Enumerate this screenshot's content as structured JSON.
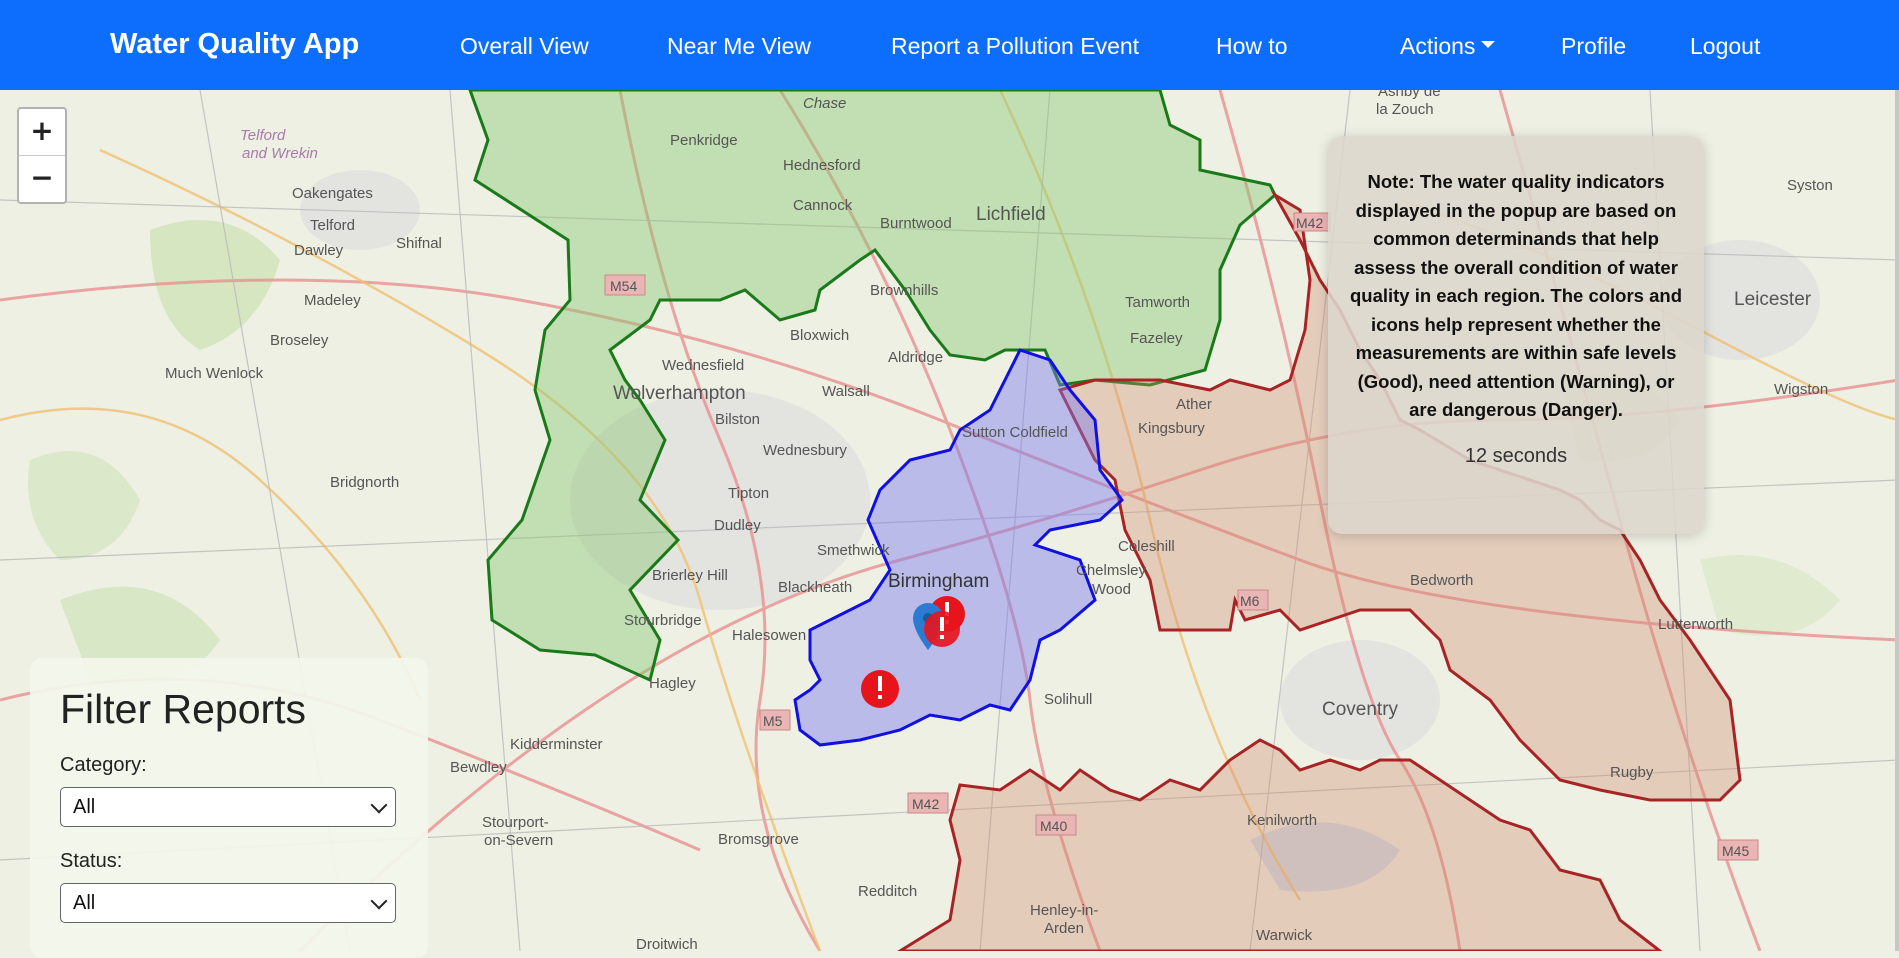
{
  "navbar": {
    "brand": "Water Quality App",
    "items": [
      {
        "label": "Overall View"
      },
      {
        "label": "Near Me View"
      },
      {
        "label": "Report a Pollution Event"
      },
      {
        "label": "How to"
      },
      {
        "label": "Actions"
      },
      {
        "label": "Profile"
      },
      {
        "label": "Logout"
      }
    ],
    "color": "#0d6efd"
  },
  "map": {
    "zoom_in": "+",
    "zoom_out": "−",
    "places": [
      "Telford and Wrekin",
      "Penkridge",
      "Hednesford",
      "Cannock",
      "Chase",
      "Lichfield",
      "Burntwood",
      "Brownhills",
      "Oakengates",
      "Telford",
      "Dawley",
      "Shifnal",
      "Madeley",
      "Broseley",
      "Much Wenlock",
      "Wolverhampton",
      "Wednesfield",
      "Bloxwich",
      "Aldridge",
      "Walsall",
      "Bilston",
      "Wednesbury",
      "Tipton",
      "Dudley",
      "Smethwick",
      "Brierley Hill",
      "Blackheath",
      "Stourbridge",
      "Halesowen",
      "Hagley",
      "Birmingham",
      "Sutton Coldfield",
      "Tamworth",
      "Fazeley",
      "Kingsbury",
      "Coleshill",
      "Chelmsley Wood",
      "Solihull",
      "Bedworth",
      "Coventry",
      "Kenilworth",
      "Warwick",
      "Rugby",
      "Lutterworth",
      "Leicester",
      "Syston",
      "Wigston",
      "Ashby de la Zouch",
      "Bridgnorth",
      "Kidderminster",
      "Bewdley",
      "Stourport-on-Severn",
      "Bromsgrove",
      "Redditch",
      "Droitwich",
      "Henley-in-Arden",
      "Ather"
    ],
    "roads": [
      "M54",
      "M5",
      "M42",
      "M40",
      "M6",
      "M45"
    ],
    "region_colors": {
      "green": "#7fbf6a",
      "blue": "#8b8bf0",
      "red": "#d9a08a"
    }
  },
  "note": {
    "bold": "Note:",
    "text": "The water quality indicators displayed in the popup are based on common determinands that help assess the overall condition of water quality in each region. The colors and icons help represent whether the measurements are within safe levels (Good), need attention (Warning), or are dangerous (Danger).",
    "timer": "12 seconds"
  },
  "filter": {
    "title": "Filter Reports",
    "category_label": "Category:",
    "category_value": "All",
    "status_label": "Status:",
    "status_value": "All"
  }
}
